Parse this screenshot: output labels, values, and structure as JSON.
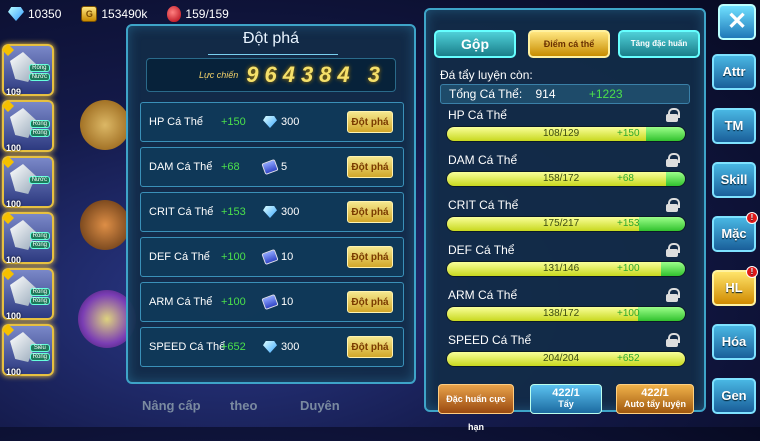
{
  "topbar": {
    "diamonds": "10350",
    "gold": "153490k",
    "stamina": "159/159"
  },
  "left_nav": [
    "Nâng cấp",
    "theo",
    "Duyên"
  ],
  "roster": [
    {
      "level": "109",
      "tags": [
        "Rồng",
        "Nước"
      ]
    },
    {
      "level": "100",
      "tags": [
        "Rồng",
        "Rồng"
      ]
    },
    {
      "level": "100",
      "tags": [
        "Nước"
      ]
    },
    {
      "level": "100",
      "tags": [
        "Rồng",
        "Rồng"
      ]
    },
    {
      "level": "100",
      "tags": [
        "Rồng",
        "Rồng"
      ]
    },
    {
      "level": "100",
      "tags": [
        "Siêu",
        "Rồng"
      ]
    }
  ],
  "breakthrough": {
    "title": "Đột phá",
    "power_label": "Lực chiến",
    "power_value": "964384 3",
    "rows": [
      {
        "name": "HP Cá Thể",
        "plus": "+150",
        "cost_icon": "diamond-icon",
        "cost": "300",
        "button": "Đột phá"
      },
      {
        "name": "DAM Cá Thể",
        "plus": "+68",
        "cost_icon": "scroll-icon",
        "cost": "5",
        "button": "Đột phá"
      },
      {
        "name": "CRIT Cá Thể",
        "plus": "+153",
        "cost_icon": "diamond-icon",
        "cost": "300",
        "button": "Đột phá"
      },
      {
        "name": "DEF Cá Thể",
        "plus": "+100",
        "cost_icon": "scroll-icon",
        "cost": "10",
        "button": "Đột phá"
      },
      {
        "name": "ARM Cá Thể",
        "plus": "+100",
        "cost_icon": "scroll-icon",
        "cost": "10",
        "button": "Đột phá"
      },
      {
        "name": "SPEED Cá Thể",
        "plus": "+652",
        "cost_icon": "diamond-icon",
        "cost": "300",
        "button": "Đột phá"
      }
    ]
  },
  "training": {
    "tabs": {
      "merge": "Gộp",
      "individual": "Điểm cá thể",
      "special": "Tăng đặc huấn"
    },
    "remaining_label": "Đá tẩy luyện còn:",
    "total_label": "Tổng Cá Thể:",
    "total_value": "914",
    "total_gain": "+1223",
    "stats": [
      {
        "name": "HP Cá Thể",
        "text": "108/129",
        "gain": "+150",
        "current": 108,
        "max": 129
      },
      {
        "name": "DAM Cá Thể",
        "text": "158/172",
        "gain": "+68",
        "current": 158,
        "max": 172
      },
      {
        "name": "CRIT Cá Thể",
        "text": "175/217",
        "gain": "+153",
        "current": 175,
        "max": 217
      },
      {
        "name": "DEF Cá Thể",
        "text": "131/146",
        "gain": "+100",
        "current": 131,
        "max": 146
      },
      {
        "name": "ARM Cá Thể",
        "text": "138/172",
        "gain": "+100",
        "current": 138,
        "max": 172
      },
      {
        "name": "SPEED Cá Thể",
        "text": "204/204",
        "gain": "+652",
        "current": 204,
        "max": 204
      }
    ],
    "buttons": {
      "special_train": "Đặc huấn cực hạn",
      "wash_count": "422/1",
      "wash_label": "Tẩy",
      "auto_count": "422/1",
      "auto_label": "Auto tẩy luyện"
    }
  },
  "side_tabs": [
    {
      "label": "Attr",
      "alert": false
    },
    {
      "label": "TM",
      "alert": false
    },
    {
      "label": "Skill",
      "alert": false
    },
    {
      "label": "Mặc",
      "alert": true
    },
    {
      "label": "HL",
      "alert": true,
      "active": true
    },
    {
      "label": "Hóa",
      "alert": false
    },
    {
      "label": "Gen",
      "alert": false
    }
  ],
  "alert_mark": "!",
  "colors": {
    "panel_border": "#3ea4c8",
    "gold_button": "#d1a72a",
    "gain_green": "#31c22e",
    "bar_yellow": "#c8d81e"
  }
}
